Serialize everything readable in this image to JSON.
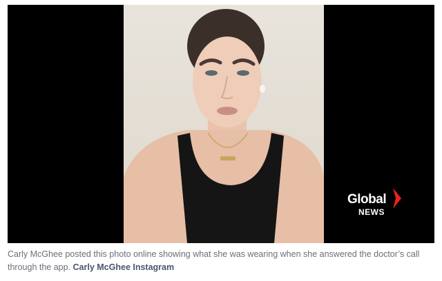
{
  "logo": {
    "word": "Global",
    "sub": "NEWS",
    "mark_color": "#e8231f"
  },
  "caption": {
    "text": "Carly McGhee posted this photo online showing what she was wearing when she answered the doctor’s call through the app.",
    "credit": "Carly McGhee Instagram"
  },
  "colors": {
    "letterbox": "#000000",
    "caption_text": "#6b6f78",
    "credit_text": "#4a5570"
  }
}
